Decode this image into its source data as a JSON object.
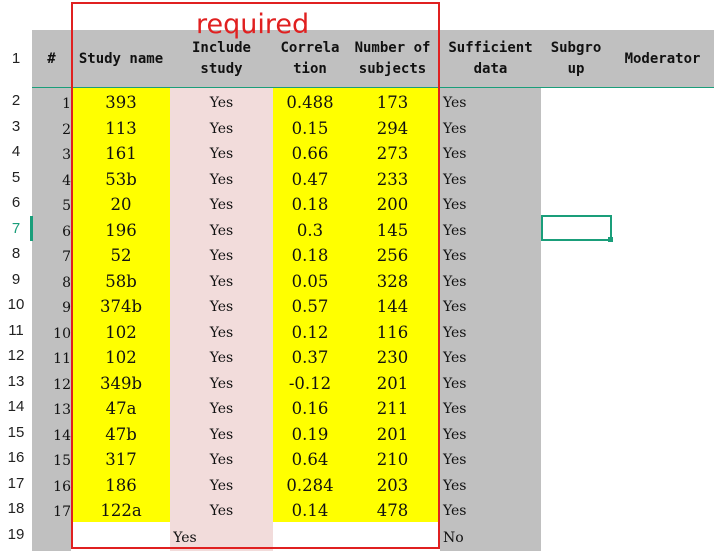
{
  "title_annotation": "required",
  "row_numbers": [
    "1",
    "2",
    "3",
    "4",
    "5",
    "6",
    "7",
    "8",
    "9",
    "10",
    "11",
    "12",
    "13",
    "14",
    "15",
    "16",
    "17",
    "18",
    "19"
  ],
  "active_row": "7",
  "headers": {
    "index": "#",
    "study_name": "Study name",
    "include_study": "Include\nstudy",
    "correlation": "Correla\ntion",
    "subjects": "Number of\nsubjects",
    "sufficient": "Sufficient\ndata",
    "subgroup": "Subgro\nup",
    "moderator": "Moderator"
  },
  "rows": [
    {
      "idx": "1",
      "study": "393",
      "include": "Yes",
      "corr": "0.488",
      "n": "173",
      "sufficient": "Yes"
    },
    {
      "idx": "2",
      "study": "113",
      "include": "Yes",
      "corr": "0.15",
      "n": "294",
      "sufficient": "Yes"
    },
    {
      "idx": "3",
      "study": "161",
      "include": "Yes",
      "corr": "0.66",
      "n": "273",
      "sufficient": "Yes"
    },
    {
      "idx": "4",
      "study": "53b",
      "include": "Yes",
      "corr": "0.47",
      "n": "233",
      "sufficient": "Yes"
    },
    {
      "idx": "5",
      "study": "20",
      "include": "Yes",
      "corr": "0.18",
      "n": "200",
      "sufficient": "Yes"
    },
    {
      "idx": "6",
      "study": "196",
      "include": "Yes",
      "corr": "0.3",
      "n": "145",
      "sufficient": "Yes"
    },
    {
      "idx": "7",
      "study": "52",
      "include": "Yes",
      "corr": "0.18",
      "n": "256",
      "sufficient": "Yes"
    },
    {
      "idx": "8",
      "study": "58b",
      "include": "Yes",
      "corr": "0.05",
      "n": "328",
      "sufficient": "Yes"
    },
    {
      "idx": "9",
      "study": "374b",
      "include": "Yes",
      "corr": "0.57",
      "n": "144",
      "sufficient": "Yes"
    },
    {
      "idx": "10",
      "study": "102",
      "include": "Yes",
      "corr": "0.12",
      "n": "116",
      "sufficient": "Yes"
    },
    {
      "idx": "11",
      "study": "102",
      "include": "Yes",
      "corr": "0.37",
      "n": "230",
      "sufficient": "Yes"
    },
    {
      "idx": "12",
      "study": "349b",
      "include": "Yes",
      "corr": "-0.12",
      "n": "201",
      "sufficient": "Yes"
    },
    {
      "idx": "13",
      "study": "47a",
      "include": "Yes",
      "corr": "0.16",
      "n": "211",
      "sufficient": "Yes"
    },
    {
      "idx": "14",
      "study": "47b",
      "include": "Yes",
      "corr": "0.19",
      "n": "201",
      "sufficient": "Yes"
    },
    {
      "idx": "15",
      "study": "317",
      "include": "Yes",
      "corr": "0.64",
      "n": "210",
      "sufficient": "Yes"
    },
    {
      "idx": "16",
      "study": "186",
      "include": "Yes",
      "corr": "0.284",
      "n": "203",
      "sufficient": "Yes"
    },
    {
      "idx": "17",
      "study": "122a",
      "include": "Yes",
      "corr": "0.14",
      "n": "478",
      "sufficient": "Yes"
    }
  ],
  "last_row": {
    "include": "Yes",
    "sufficient": "No"
  },
  "colors": {
    "header_gray": "#c0c0c0",
    "highlight_yellow": "#ffff00",
    "include_pink": "#f2dcdb",
    "annotation_red": "#e02020",
    "selection_green": "#1a9e7a"
  }
}
